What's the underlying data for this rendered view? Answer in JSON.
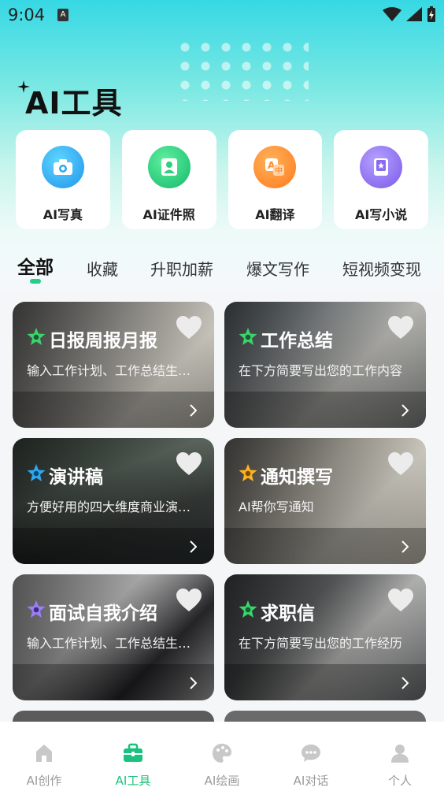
{
  "status_bar": {
    "time": "9:04",
    "sim_label": "A"
  },
  "page_title": "AI工具",
  "tools": [
    {
      "label": "AI写真",
      "icon": "camera-icon",
      "color": "#2aa7f0"
    },
    {
      "label": "AI证件照",
      "icon": "id-photo-icon",
      "color": "#2ed07e"
    },
    {
      "label": "AI翻译",
      "icon": "translate-icon",
      "color": "#ff8a2a"
    },
    {
      "label": "AI写小说",
      "icon": "book-icon",
      "color": "#8b6cf0"
    }
  ],
  "tabs": [
    "全部",
    "收藏",
    "升职加薪",
    "爆文写作",
    "短视频变现"
  ],
  "cards": [
    {
      "title": "日报周报月报",
      "desc": "输入工作计划、工作总结生成日报",
      "star_color": "#3bd36b"
    },
    {
      "title": "工作总结",
      "desc": "在下方简要写出您的工作内容",
      "star_color": "#3bd36b"
    },
    {
      "title": "演讲稿",
      "desc": "方便好用的四大维度商业演讲稿",
      "star_color": "#2ea8f5"
    },
    {
      "title": "通知撰写",
      "desc": "AI帮你写通知",
      "star_color": "#ffb21f"
    },
    {
      "title": "面试自我介绍",
      "desc": "输入工作计划、工作总结生成介绍",
      "star_color": "#9b7ff5"
    },
    {
      "title": "求职信",
      "desc": "在下方简要写出您的工作经历",
      "star_color": "#3bd36b"
    }
  ],
  "nav": [
    {
      "label": "AI创作",
      "icon": "home-icon"
    },
    {
      "label": "AI工具",
      "icon": "toolbox-icon"
    },
    {
      "label": "AI绘画",
      "icon": "palette-icon"
    },
    {
      "label": "AI对话",
      "icon": "chat-icon"
    },
    {
      "label": "个人",
      "icon": "person-icon"
    }
  ],
  "colors": {
    "accent": "#19c27e",
    "hero_top": "#36d8e4"
  }
}
